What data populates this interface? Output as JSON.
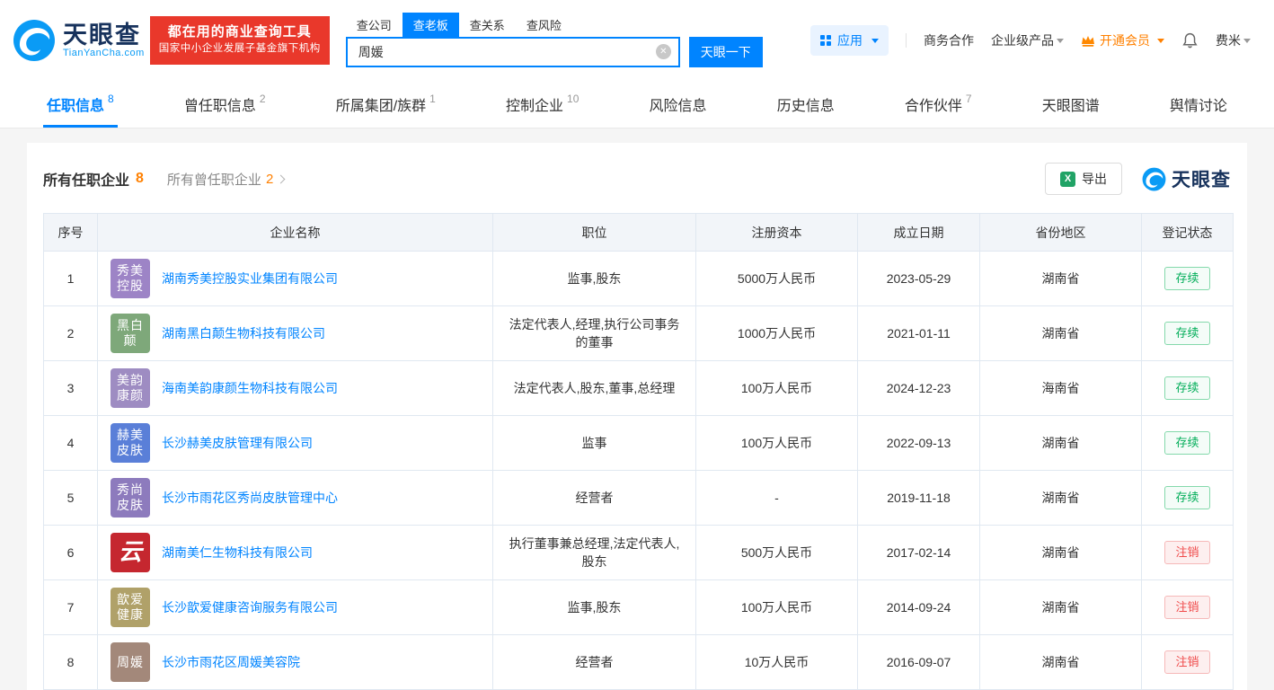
{
  "brand": {
    "name": "天眼查",
    "domain": "TianYanCha.com",
    "slogan_line1": "都在用的商业查询工具",
    "slogan_line2": "国家中小企业发展子基金旗下机构"
  },
  "icons": {
    "clear": "✕",
    "excel": "X"
  },
  "search": {
    "tabs": [
      {
        "label": "查公司",
        "active": false
      },
      {
        "label": "查老板",
        "active": true
      },
      {
        "label": "查关系",
        "active": false
      },
      {
        "label": "查风险",
        "active": false
      }
    ],
    "value": "周媛",
    "button_label": "天眼一下"
  },
  "header_nav": {
    "apps_label": "应用",
    "business_coop": "商务合作",
    "enterprise_product": "企业级产品",
    "vip_label": "开通会员",
    "user_name": "费米"
  },
  "page_tabs": [
    {
      "label": "任职信息",
      "count": "8",
      "active": true
    },
    {
      "label": "曾任职信息",
      "count": "2",
      "active": false
    },
    {
      "label": "所属集团/族群",
      "count": "1",
      "active": false
    },
    {
      "label": "控制企业",
      "count": "10",
      "active": false
    },
    {
      "label": "风险信息",
      "count": "",
      "active": false
    },
    {
      "label": "历史信息",
      "count": "",
      "active": false
    },
    {
      "label": "合作伙伴",
      "count": "7",
      "active": false
    },
    {
      "label": "天眼图谱",
      "count": "",
      "active": false
    },
    {
      "label": "舆情讨论",
      "count": "",
      "active": false
    }
  ],
  "section": {
    "current_label": "所有任职企业",
    "current_count": "8",
    "former_label": "所有曾任职企业",
    "former_count": "2",
    "export_label": "导出",
    "brand_mark": "天眼查"
  },
  "colors": {
    "brand_blue": "#0084ff",
    "promo_red": "#e9382b",
    "vip_orange": "#ff8000",
    "status_active": "#00ad58",
    "status_cancelled": "#f04b4b"
  },
  "table": {
    "columns": [
      "序号",
      "企业名称",
      "职位",
      "注册资本",
      "成立日期",
      "省份地区",
      "登记状态"
    ],
    "rows": [
      {
        "index": "1",
        "logo": {
          "lines": [
            "秀美",
            "控股"
          ],
          "bg": "#9d84c6",
          "script": false
        },
        "company": "湖南秀美控股实业集团有限公司",
        "position": "监事,股东",
        "capital": "5000万人民币",
        "established": "2023-05-29",
        "region": "湖南省",
        "status": "存续",
        "status_type": "active"
      },
      {
        "index": "2",
        "logo": {
          "lines": [
            "黑白",
            "颠"
          ],
          "bg": "#7ea87a",
          "script": false
        },
        "company": "湖南黑白颠生物科技有限公司",
        "position": "法定代表人,经理,执行公司事务的董事",
        "capital": "1000万人民币",
        "established": "2021-01-11",
        "region": "湖南省",
        "status": "存续",
        "status_type": "active"
      },
      {
        "index": "3",
        "logo": {
          "lines": [
            "美韵",
            "康颜"
          ],
          "bg": "#9e8cc2",
          "script": false
        },
        "company": "海南美韵康颜生物科技有限公司",
        "position": "法定代表人,股东,董事,总经理",
        "capital": "100万人民币",
        "established": "2024-12-23",
        "region": "海南省",
        "status": "存续",
        "status_type": "active"
      },
      {
        "index": "4",
        "logo": {
          "lines": [
            "赫美",
            "皮肤"
          ],
          "bg": "#5a7fd8",
          "script": false
        },
        "company": "长沙赫美皮肤管理有限公司",
        "position": "监事",
        "capital": "100万人民币",
        "established": "2022-09-13",
        "region": "湖南省",
        "status": "存续",
        "status_type": "active"
      },
      {
        "index": "5",
        "logo": {
          "lines": [
            "秀尚",
            "皮肤"
          ],
          "bg": "#8d7bbd",
          "script": false
        },
        "company": "长沙市雨花区秀尚皮肤管理中心",
        "position": "经营者",
        "capital": "-",
        "established": "2019-11-18",
        "region": "湖南省",
        "status": "存续",
        "status_type": "active"
      },
      {
        "index": "6",
        "logo": {
          "lines": [
            "云"
          ],
          "bg": "#c5272f",
          "script": true
        },
        "company": "湖南美仁生物科技有限公司",
        "position": "执行董事兼总经理,法定代表人,股东",
        "capital": "500万人民币",
        "established": "2017-02-14",
        "region": "湖南省",
        "status": "注销",
        "status_type": "cancelled"
      },
      {
        "index": "7",
        "logo": {
          "lines": [
            "歆爱",
            "健康"
          ],
          "bg": "#b0a169",
          "script": false
        },
        "company": "长沙歆爱健康咨询服务有限公司",
        "position": "监事,股东",
        "capital": "100万人民币",
        "established": "2014-09-24",
        "region": "湖南省",
        "status": "注销",
        "status_type": "cancelled"
      },
      {
        "index": "8",
        "logo": {
          "lines": [
            "周媛"
          ],
          "bg": "#a3887a",
          "script": false
        },
        "company": "长沙市雨花区周媛美容院",
        "position": "经营者",
        "capital": "10万人民币",
        "established": "2016-09-07",
        "region": "湖南省",
        "status": "注销",
        "status_type": "cancelled"
      }
    ]
  }
}
